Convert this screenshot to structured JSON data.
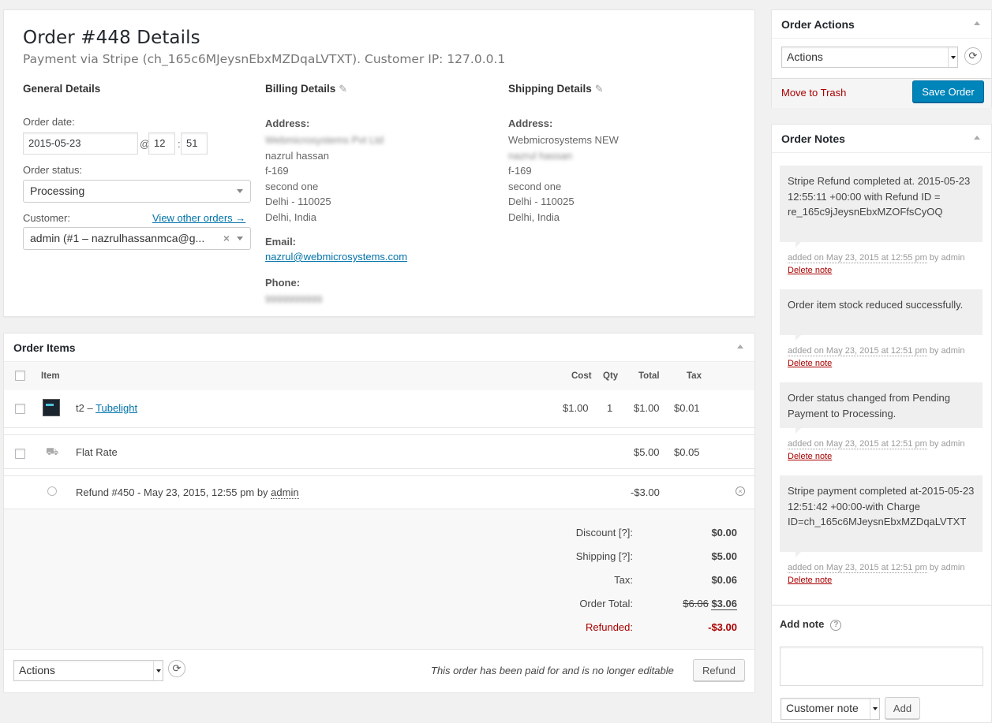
{
  "order": {
    "title": "Order #448 Details",
    "subtitle": "Payment via Stripe (ch_165c6MJeysnEbxMZDqaLVTXT). Customer IP: 127.0.0.1"
  },
  "general": {
    "heading": "General Details",
    "order_date_label": "Order date:",
    "order_date": "2015-05-23",
    "at_sep": "@",
    "hour": "12",
    "time_sep": ":",
    "minute": "51",
    "status_label": "Order status:",
    "status": "Processing",
    "customer_label": "Customer:",
    "view_other_orders": "View other orders →",
    "customer": "admin (#1 – nazrulhassanmca@g...",
    "clear_symbol": "×"
  },
  "billing": {
    "heading": "Billing Details",
    "pencil": "✎",
    "address_label": "Address:",
    "address_lines": [
      "Webmicrosystems Pvt Ltd",
      "nazrul hassan",
      "f-169",
      "second one",
      "Delhi - 110025",
      "Delhi, India"
    ],
    "email_label": "Email:",
    "email": "nazrul@webmicrosystems.com",
    "phone_label": "Phone:",
    "phone": "9999999999"
  },
  "shipping": {
    "heading": "Shipping Details",
    "pencil": "✎",
    "address_label": "Address:",
    "address_lines": [
      "Webmicrosystems NEW",
      "nazrul hassan",
      "f-169",
      "second one",
      "Delhi - 110025",
      "Delhi, India"
    ]
  },
  "items": {
    "heading": "Order Items",
    "columns": {
      "item": "Item",
      "cost": "Cost",
      "qty": "Qty",
      "total": "Total",
      "tax": "Tax"
    },
    "product": {
      "prefix": "t2 – ",
      "name": "Tubelight",
      "cost": "$1.00",
      "qty": "1",
      "total": "$1.00",
      "tax": "$0.01"
    },
    "shipping_row": {
      "name": "Flat Rate",
      "total": "$5.00",
      "tax": "$0.05"
    },
    "refund_row": {
      "text": "Refund #450 - May 23, 2015, 12:55 pm by ",
      "by": "admin",
      "amount": "-$3.00"
    },
    "totals": {
      "discount_label": "Discount [?]:",
      "discount": "$0.00",
      "shipping_label": "Shipping [?]:",
      "shipping": "$5.00",
      "tax_label": "Tax:",
      "tax": "$0.06",
      "order_total_label": "Order Total:",
      "order_total_old": "$6.06",
      "order_total": "$3.06",
      "refunded_label": "Refunded:",
      "refunded": "-$3.00"
    },
    "footer": {
      "actions_select": "Actions",
      "refresh": "⟳",
      "notice": "This order has been paid for and is no longer editable",
      "refund_button": "Refund"
    }
  },
  "order_actions": {
    "heading": "Order Actions",
    "select": "Actions",
    "refresh": "⟳",
    "trash": "Move to Trash",
    "save": "Save Order"
  },
  "notes": {
    "heading": "Order Notes",
    "list": [
      {
        "text": "Stripe Refund completed at. 2015-05-23 12:55:11 +00:00 with Refund ID = re_165c9jJeysnEbxMZOFfsCyOQ",
        "added": "added on May 23, 2015 at 12:55 pm",
        "by": " by admin ",
        "delete": "Delete note"
      },
      {
        "text": "Order item stock reduced successfully.",
        "added": "added on May 23, 2015 at 12:51 pm",
        "by": " by admin ",
        "delete": "Delete note"
      },
      {
        "text": "Order status changed from Pending Payment to Processing.",
        "added": "added on May 23, 2015 at 12:51 pm",
        "by": " by admin ",
        "delete": "Delete note"
      },
      {
        "text": "Stripe payment completed at-2015-05-23 12:51:42 +00:00-with Charge ID=ch_165c6MJeysnEbxMZDqaLVTXT",
        "added": "added on May 23, 2015 at 12:51 pm",
        "by": " by admin ",
        "delete": "Delete note"
      }
    ],
    "add_note_label": "Add note",
    "help": "?",
    "note_type": "Customer note",
    "add_button": "Add"
  },
  "colors": {
    "accent": "#0085ba",
    "link": "#0073aa",
    "danger": "#a00"
  }
}
